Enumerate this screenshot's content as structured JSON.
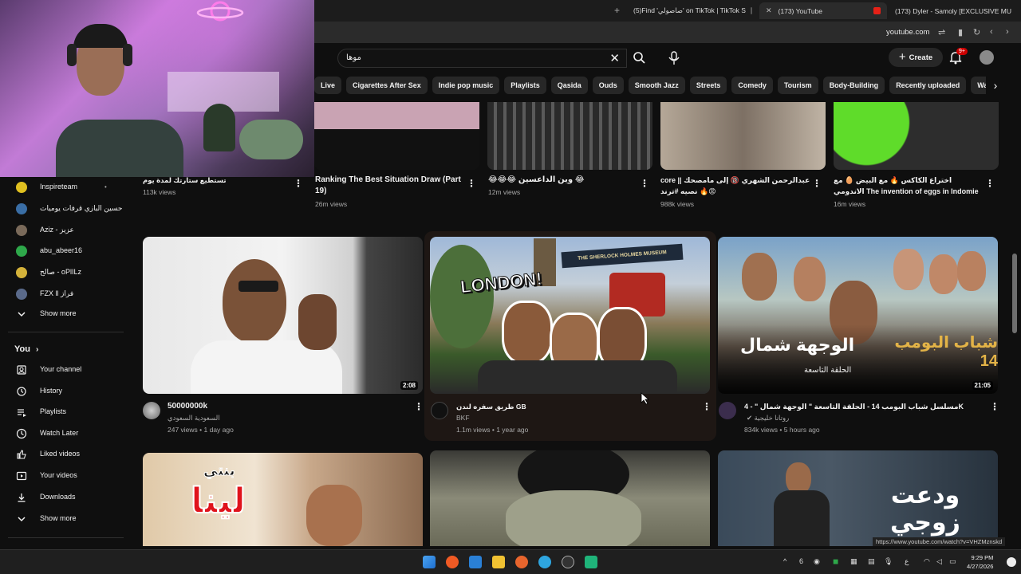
{
  "browser": {
    "tabs": [
      {
        "label": "(5)Find 'صاصولي' on TikTok | TikTok S"
      },
      {
        "label": "(173) YouTube"
      },
      {
        "label": "(173) Dyler - Samoly [EXCLUSIVE MU"
      }
    ],
    "address": "youtube.com"
  },
  "header": {
    "search_value": "موها",
    "create_label": "Create",
    "notif_badge": "9+"
  },
  "chips": [
    "Live",
    "Cigarettes After Sex",
    "Indie pop music",
    "Playlists",
    "Qasida",
    "Ouds",
    "Smooth Jazz",
    "Streets",
    "Comedy",
    "Tourism",
    "Body-Building",
    "Recently uploaded",
    "Wa"
  ],
  "sidebar": {
    "subscriptions": [
      {
        "label": "Inspireteam",
        "dot": "•",
        "color": "#e0c020"
      },
      {
        "label": "حسين البازي قرفات يوميات",
        "dot": "",
        "color": "#3a6ea5"
      },
      {
        "label": "Aziz - عزيز",
        "dot": "",
        "color": "#7a6a5a"
      },
      {
        "label": "abu_abeer16",
        "dot": "",
        "color": "#2ea84a"
      },
      {
        "label": "صالح - oPlILz",
        "dot": "",
        "color": "#d4b23a"
      },
      {
        "label": "FZX ll فراز",
        "dot": "",
        "color": "#5a6a8a"
      }
    ],
    "show_more_1": "Show more",
    "you_heading": "You",
    "you_items": [
      {
        "label": "Your channel",
        "icon": "channel-icon"
      },
      {
        "label": "History",
        "icon": "history-icon"
      },
      {
        "label": "Playlists",
        "icon": "playlists-icon"
      },
      {
        "label": "Watch Later",
        "icon": "clock-icon"
      },
      {
        "label": "Liked videos",
        "icon": "thumbs-up-icon"
      },
      {
        "label": "Your videos",
        "icon": "play-square-icon"
      },
      {
        "label": "Downloads",
        "icon": "download-icon"
      }
    ],
    "show_more_2": "Show more"
  },
  "row1": [
    {
      "title": "تستطيع ستارتك لمدة يوم",
      "views": "113k views"
    },
    {
      "title": "Ranking The Best Situation Draw (Part 19)",
      "views": "26m views"
    },
    {
      "title": "😂😂😂 وين الداعسين 😂",
      "views": "12m views"
    },
    {
      "title": "core || عبدالرحمن الشهري 🔞 إلى مامصحك نصيه #ترند 🔥😡",
      "views": "988k views"
    },
    {
      "title": "اختراع الكاكس 🔥 مع البيض 🥚 مع الاندومي The invention of eggs in Indomie wit...",
      "views": "16m views"
    }
  ],
  "row2": [
    {
      "title": "50000000k",
      "channel": "السعودية السعودي",
      "meta": "247 views • 1 day ago",
      "duration": "2:08"
    },
    {
      "title": "طريق سفره لندن GB",
      "channel": "BKF",
      "meta": "1.1m views • 1 year ago",
      "duration": ""
    },
    {
      "title": "مسلسل شباب البومب 14 - الحلقة التاسعة \" الوجهة شمال \" - 4K",
      "channel": "روتانا خليجية",
      "meta": "834k views • 5 hours ago",
      "duration": "21:05"
    }
  ],
  "thumb_text": {
    "london": "LONDON!",
    "museum": "THE SHERLOCK HOLMES MUSEUM",
    "show_title": "الوجهة شمال",
    "show_sub": "الحلقة التاسعة",
    "show_logo": "شباب البومب 14",
    "lina": "لينا",
    "lina_small": "بنتي",
    "wada": "ودعت زوجي"
  },
  "status_url": "https://www.youtube.com/watch?v=VHZMznskd",
  "taskbar": {
    "time": "9:29 PM",
    "date": "4/27/2026",
    "lang": "ع"
  }
}
